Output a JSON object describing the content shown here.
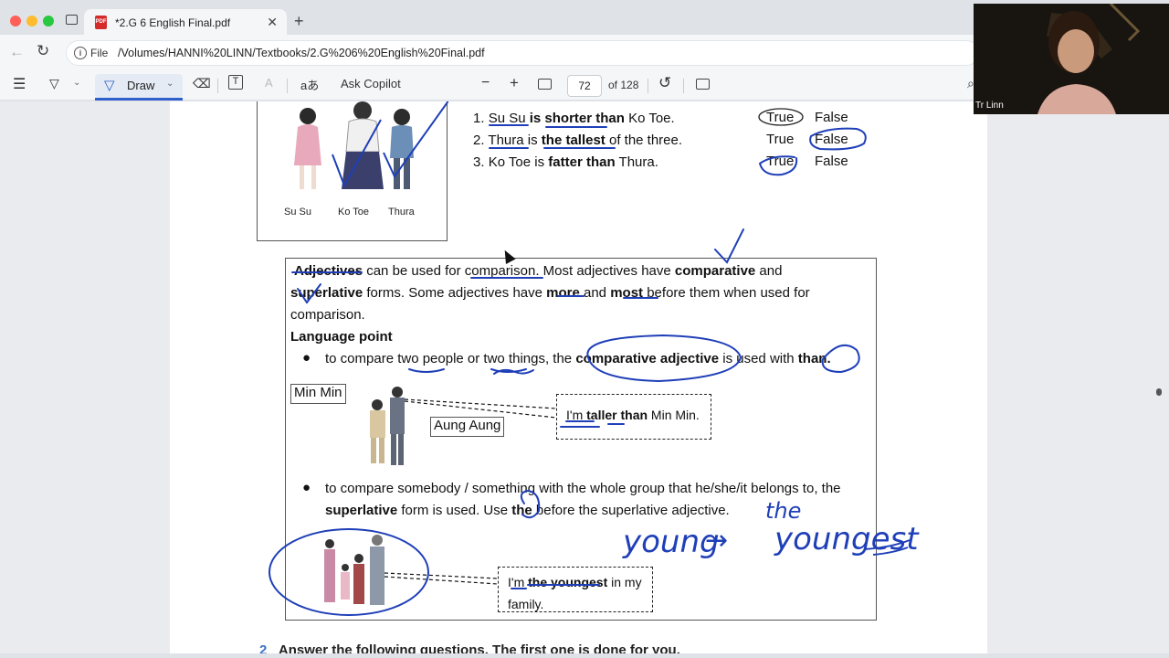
{
  "browser": {
    "tab_title": "*2.G 6 English Final.pdf",
    "url_prefix": "File",
    "url": "/Volumes/HANNI%20LINN/Textbooks/2.G%206%20English%20Final.pdf"
  },
  "toolbar": {
    "draw_label": "Draw",
    "ask_copilot": "Ask Copilot",
    "page_number": "72",
    "page_total": "of 128",
    "minus": "−",
    "plus": "+"
  },
  "webcam": {
    "name": "Tr Linn"
  },
  "page": {
    "picture_labels": [
      "Su Su",
      "Ko Toe",
      "Thura"
    ],
    "statements": [
      {
        "num": "1.",
        "pre": "Su Su ",
        "bold": "is shorter than",
        "post": " Ko Toe.",
        "true": "True",
        "false": "False"
      },
      {
        "num": "2.",
        "pre": "Thura is ",
        "bold": "the tallest",
        "post": " of the three.",
        "true": "True",
        "false": "False"
      },
      {
        "num": "3.",
        "pre": "Ko Toe is ",
        "bold": "fatter than",
        "post": " Thura.",
        "true": "True",
        "false": "False"
      }
    ],
    "grammar": {
      "line1_b1": "Adjectives",
      "line1_t1": " can be used for comparison. Most adjectives have ",
      "line1_b2": "comparative",
      "line1_t2": " and",
      "line2_b1": "superlative",
      "line2_t1": " forms. Some adjectives have ",
      "line2_b2": "more",
      "line2_t2": " and ",
      "line2_b3": "most",
      "line2_t3": " before them when used for",
      "line3": "comparison.",
      "heading": "Language point",
      "bullet1_t1": "to compare two people or two things, the ",
      "bullet1_b1": "comparative adjective",
      "bullet1_t2": " is used with ",
      "bullet1_b2": "than.",
      "min_min": "Min Min",
      "aung_aung": "Aung Aung",
      "bubble1_t1": "I'm ",
      "bubble1_b1": "taller than",
      "bubble1_t2": " Min Min.",
      "bullet2_l1": "to compare somebody / something with the whole group that he/she/it belongs to, the",
      "bullet2_b1": "superlative",
      "bullet2_t1": " form is used. Use ",
      "bullet2_b2": "the",
      "bullet2_t2": " before the superlative adjective.",
      "bubble2_t1": "I'm ",
      "bubble2_b1": "the youngest",
      "bubble2_t2": " in my",
      "bubble2_l2": "family."
    },
    "handwriting": {
      "young": "young",
      "arrow": "→",
      "the": "the",
      "youngest": "youngest"
    },
    "next_question": "Answer the following questions. The first one is done for you."
  },
  "colors": {
    "ink": "#1f3fb8",
    "accent": "#2f5fcb"
  }
}
